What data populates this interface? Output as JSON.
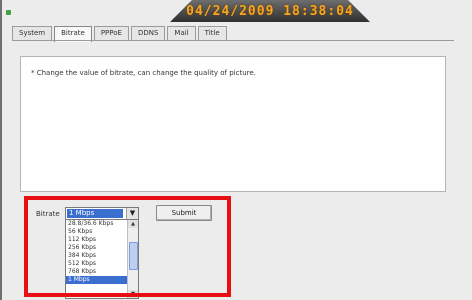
{
  "titlebar": {
    "datetime": "04/24/2009 18:38:04"
  },
  "tabs": [
    {
      "label": "System"
    },
    {
      "label": "Bitrate"
    },
    {
      "label": "PPPoE"
    },
    {
      "label": "DDNS"
    },
    {
      "label": "Mail"
    },
    {
      "label": "Title"
    }
  ],
  "info": {
    "text": "* Change the value of bitrate, can change the quality of picture."
  },
  "form": {
    "bitrate_label": "Bitrate",
    "selected_value": "1 Mbps",
    "options": [
      "28.8/36.6 Kbps",
      "56 Kbps",
      "112 Kbps",
      "256 Kbps",
      "384 Kbps",
      "512 Kbps",
      "768 Kbps",
      "1 Mbps"
    ],
    "arrow_glyph": "▼",
    "submit_label": "Submit"
  },
  "colors": {
    "selection": "#3a6fd0",
    "highlight": "#e50f14",
    "title_text": "#f5a623"
  }
}
